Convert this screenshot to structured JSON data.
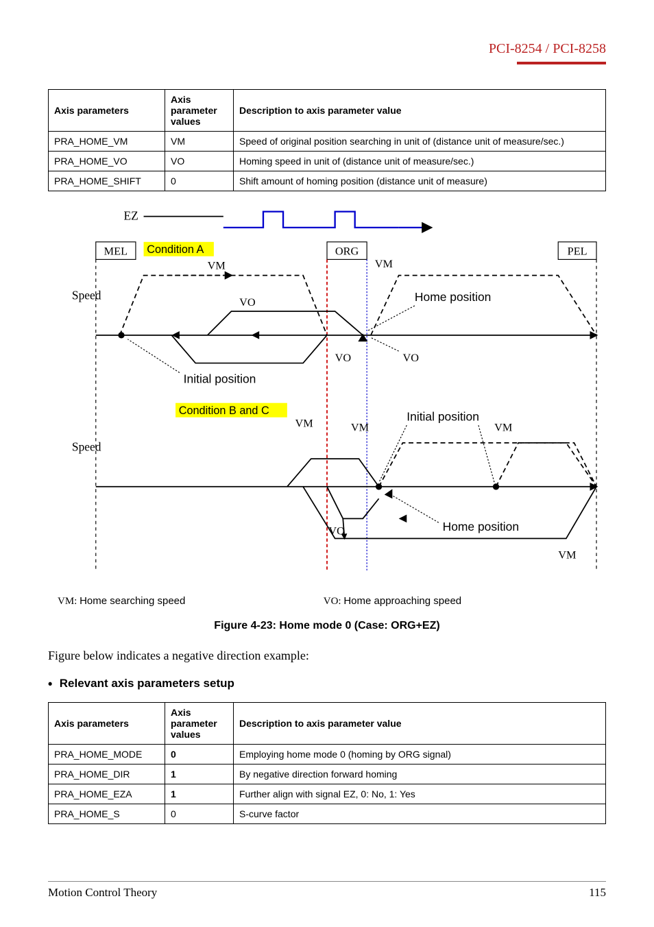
{
  "header": {
    "title": "PCI-8254 / PCI-8258"
  },
  "table1": {
    "headers": [
      "Axis parameters",
      "Axis parameter values",
      "Description to axis parameter value"
    ],
    "rows": [
      {
        "p": "PRA_HOME_VM",
        "v": "VM",
        "d": "Speed of original position searching in unit of (distance unit of measure/sec.)"
      },
      {
        "p": "PRA_HOME_VO",
        "v": "VO",
        "d": "Homing speed in unit of (distance unit of measure/sec.)"
      },
      {
        "p": "PRA_HOME_SHIFT",
        "v": "0",
        "d": "Shift amount of homing position (distance unit of measure)"
      }
    ]
  },
  "diagram": {
    "ez": "EZ",
    "mel": "MEL",
    "org": "ORG",
    "pel": "PEL",
    "speed": "Speed",
    "condA": "Condition A",
    "condBC": "Condition B and C",
    "vm": "VM",
    "vo": "VO",
    "home_position": "Home position",
    "initial_position": "Initial position",
    "legend_vm_label": "VM:",
    "legend_vm_text": "Home searching speed",
    "legend_vo_label": "VO:",
    "legend_vo_text": "Home approaching speed"
  },
  "figure_caption": "Figure 4-23: Home mode 0 (Case: ORG+EZ)",
  "body_text": "Figure below indicates a negative direction example:",
  "bullet": "Relevant axis parameters setup",
  "table2": {
    "headers": [
      "Axis parameters",
      "Axis parameter values",
      "Description to axis parameter value"
    ],
    "rows": [
      {
        "p": "PRA_HOME_MODE",
        "v": "0",
        "d": "Employing home mode 0 (homing by ORG signal)"
      },
      {
        "p": "PRA_HOME_DIR",
        "v": "1",
        "d": "By negative direction forward homing"
      },
      {
        "p": "PRA_HOME_EZA",
        "v": "1",
        "d": "Further align with signal EZ, 0: No, 1: Yes"
      },
      {
        "p": "PRA_HOME_S",
        "v": "0",
        "d": "S-curve factor"
      }
    ]
  },
  "footer": {
    "left": "Motion Control Theory",
    "right": "115"
  },
  "chart_data": {
    "type": "diagram",
    "title": "Home mode 0 (Case: ORG+EZ)",
    "signals": [
      "EZ",
      "ORG"
    ],
    "limits": [
      "MEL",
      "PEL"
    ],
    "conditions": [
      {
        "name": "Condition A",
        "initial_side": "left-of-ORG",
        "sequence": [
          "move +VM until ORG",
          "reverse -VO past ORG",
          "forward VO to EZ",
          "home at EZ past ORG"
        ]
      },
      {
        "name": "Condition B and C",
        "initial_side": "right-of-ORG",
        "sequence": [
          "move +VM to PEL",
          "reverse -VM to before ORG",
          "-VO through ORG",
          "forward VO to EZ",
          "home at EZ past ORG"
        ]
      }
    ],
    "speeds": {
      "VM": "Home searching speed",
      "VO": "Home approaching speed"
    }
  }
}
